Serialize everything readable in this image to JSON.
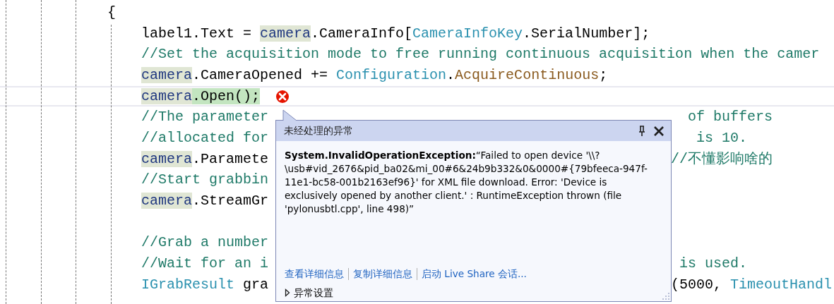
{
  "editor": {
    "lines": [
      {
        "kind": "brace",
        "left": [
          {
            "text": "{",
            "kind": "plain"
          }
        ]
      },
      {
        "kind": "code",
        "left": [
          {
            "text": "label1.Text = ",
            "kind": "plain"
          },
          {
            "text": "camera",
            "kind": "var"
          },
          {
            "text": ".CameraInfo[",
            "kind": "plain"
          },
          {
            "text": "CameraInfoKey",
            "kind": "type"
          },
          {
            "text": ".SerialNumber];",
            "kind": "plain"
          }
        ]
      },
      {
        "kind": "code",
        "left": [
          {
            "text": "//Set the acquisition mode to free running continuous acquisition when the camer",
            "kind": "comment"
          }
        ]
      },
      {
        "kind": "code",
        "left": [
          {
            "text": "camera",
            "kind": "var"
          },
          {
            "text": ".CameraOpened += ",
            "kind": "plain"
          },
          {
            "text": "Configuration",
            "kind": "type"
          },
          {
            "text": ".",
            "kind": "plain"
          },
          {
            "text": "AcquireContinuous",
            "kind": "method"
          },
          {
            "text": ";",
            "kind": "plain"
          }
        ]
      },
      {
        "kind": "code",
        "current": true,
        "error": true,
        "left": [
          {
            "text": "camera",
            "kind": "var"
          },
          {
            "text": ".Open();",
            "kind": "active"
          }
        ]
      },
      {
        "kind": "code",
        "left": [
          {
            "text": "//The parameter",
            "kind": "comment"
          }
        ],
        "right": [
          {
            "text": "  of buffers",
            "kind": "comment"
          }
        ]
      },
      {
        "kind": "code",
        "left": [
          {
            "text": "//allocated for",
            "kind": "comment"
          }
        ],
        "right": [
          {
            "text": "   is 10.",
            "kind": "comment"
          }
        ]
      },
      {
        "kind": "code",
        "left": [
          {
            "text": "camera",
            "kind": "var"
          },
          {
            "text": ".Paramete",
            "kind": "plain"
          }
        ],
        "right": [
          {
            "text": "//不懂影响啥的",
            "kind": "comment"
          }
        ]
      },
      {
        "kind": "code",
        "left": [
          {
            "text": "//Start grabbin",
            "kind": "comment"
          }
        ]
      },
      {
        "kind": "code",
        "left": [
          {
            "text": "camera",
            "kind": "var"
          },
          {
            "text": ".StreamGr",
            "kind": "plain"
          }
        ]
      },
      {
        "kind": "code"
      },
      {
        "kind": "code",
        "left": [
          {
            "text": "//Grab a number",
            "kind": "comment"
          }
        ]
      },
      {
        "kind": "code",
        "left": [
          {
            "text": "//Wait for an i",
            "kind": "comment"
          }
        ],
        "right": [
          {
            "text": " is used.",
            "kind": "comment"
          }
        ]
      },
      {
        "kind": "code",
        "left": [
          {
            "text": "IGrabResult",
            "kind": "type"
          },
          {
            "text": " gra",
            "kind": "plain"
          }
        ],
        "right": [
          {
            "text": "(5000, ",
            "kind": "plain"
          },
          {
            "text": "TimeoutHandl",
            "kind": "type"
          }
        ]
      }
    ]
  },
  "exception_popup": {
    "title": "未经处理的异常",
    "message": "**System.InvalidOperationException:**“Failed to open device '\\\\?\\usb#vid_2676&pid_ba02&mi_00#6&24b9b332&0&0000#{79bfeeca-947f-11e1-bc58-001b2163ef96}' for XML file download. Error: 'Device is exclusively opened by another client.' : RuntimeException thrown (file 'pylonusbtl.cpp', line 498)”",
    "links": [
      "查看详细信息",
      "复制详细信息",
      "启动 Live Share 会话..."
    ],
    "settings": {
      "label": "异常设置",
      "expanded": false
    }
  }
}
